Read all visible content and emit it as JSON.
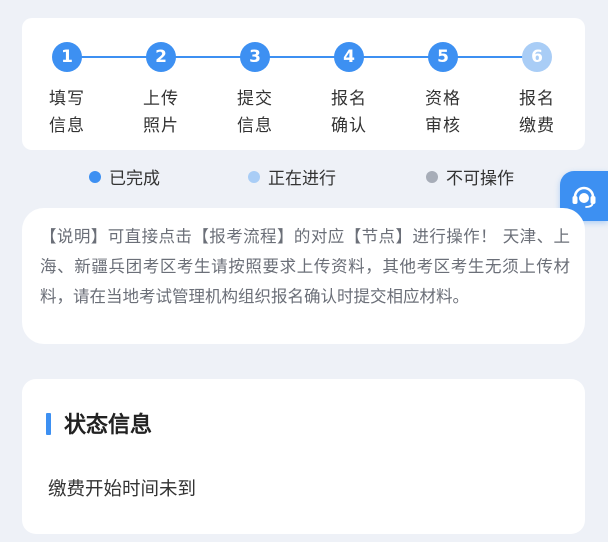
{
  "steps": [
    {
      "number": "1",
      "line1": "填写",
      "line2": "信息",
      "state": "done"
    },
    {
      "number": "2",
      "line1": "上传",
      "line2": "照片",
      "state": "done"
    },
    {
      "number": "3",
      "line1": "提交",
      "line2": "信息",
      "state": "done"
    },
    {
      "number": "4",
      "line1": "报名",
      "line2": "确认",
      "state": "done"
    },
    {
      "number": "5",
      "line1": "资格",
      "line2": "审核",
      "state": "done"
    },
    {
      "number": "6",
      "line1": "报名",
      "line2": "缴费",
      "state": "active"
    }
  ],
  "legend": [
    {
      "label": "已完成",
      "color": "#3d90f2"
    },
    {
      "label": "正在进行",
      "color": "#a9cdf6"
    },
    {
      "label": "不可操作",
      "color": "#a7adb8"
    }
  ],
  "note": {
    "text": "【说明】可直接点击【报考流程】的对应【节点】进行操作！ 天津、上海、新疆兵团考区考生请按照要求上传资料，其他考区考生无须上传材料，请在当地考试管理机构组织报名确认时提交相应材料。"
  },
  "status": {
    "title": "状态信息",
    "message": "缴费开始时间未到"
  },
  "support": {
    "icon": "headset-icon"
  }
}
